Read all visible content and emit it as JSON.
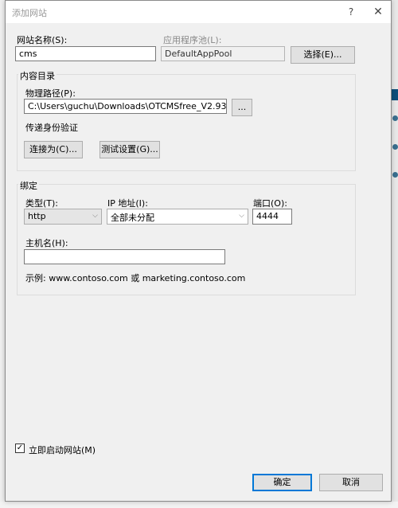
{
  "dialog": {
    "title": "添加网站",
    "help_label": "?",
    "close_label": "✕"
  },
  "site": {
    "name_label": "网站名称(S):",
    "name_value": "cms",
    "pool_label": "应用程序池(L):",
    "pool_value": "DefaultAppPool",
    "select_button": "选择(E)..."
  },
  "content": {
    "group_title": "内容目录",
    "path_label": "物理路径(P):",
    "path_value": "C:\\Users\\guchu\\Downloads\\OTCMSfree_V2.93",
    "browse_button": "...",
    "auth_label": "传递身份验证",
    "connect_button": "连接为(C)...",
    "test_button": "测试设置(G)..."
  },
  "binding": {
    "group_title": "绑定",
    "type_label": "类型(T):",
    "type_value": "http",
    "ip_label": "IP 地址(I):",
    "ip_value": "全部未分配",
    "port_label": "端口(O):",
    "port_value": "4444",
    "host_label": "主机名(H):",
    "host_value": "",
    "example_text": "示例: www.contoso.com 或 marketing.contoso.com"
  },
  "start": {
    "checked": true,
    "check_mark": "✓",
    "label": "立即启动网站(M)"
  },
  "footer": {
    "ok_button": "确定",
    "cancel_button": "取消"
  },
  "colors": {
    "accent": "#0078d7",
    "dialog_bg": "#f0f0f0"
  }
}
